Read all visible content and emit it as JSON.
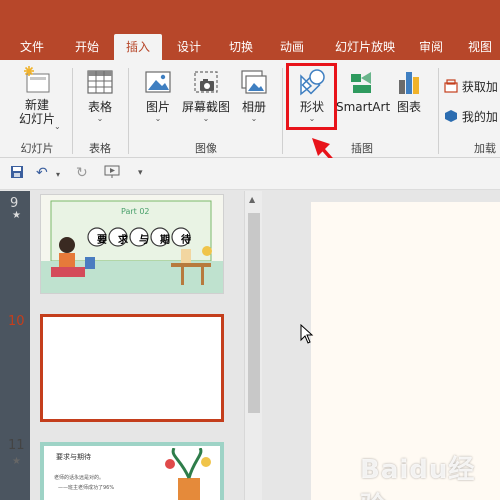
{
  "tabs": [
    "文件",
    "开始",
    "插入",
    "设计",
    "切换",
    "动画",
    "幻灯片放映",
    "审阅",
    "视图"
  ],
  "active_tab": "插入",
  "ribbon": {
    "new_slide": {
      "label1": "新建",
      "label2": "幻灯片"
    },
    "table": {
      "label": "表格"
    },
    "picture": {
      "label": "图片"
    },
    "screenshot": {
      "label": "屏幕截图"
    },
    "album": {
      "label": "相册"
    },
    "shapes": {
      "label": "形状"
    },
    "smartart": {
      "label": "SmartArt"
    },
    "chart": {
      "label": "图表"
    },
    "get_addins": {
      "label": "获取加"
    },
    "my_addins": {
      "label": "我的加"
    },
    "groups": {
      "slides": "幻灯片",
      "tables": "表格",
      "images": "图像",
      "illustrations": "插图",
      "addins": "加载"
    }
  },
  "slides_panel": {
    "items": [
      {
        "number": "9",
        "title_en": "Part 02",
        "title_cn": [
          "要",
          "求",
          "与",
          "期",
          "待"
        ]
      },
      {
        "number": "10"
      },
      {
        "number": "11",
        "heading": "要求与期待",
        "line1": "老师的话永远是对的。",
        "line2": "——班主老师成功了96%"
      }
    ]
  },
  "colors": {
    "brand": "#b7472a",
    "highlight": "#e8131a",
    "selected": "#c43e1c"
  },
  "watermark": "Baidu经验"
}
